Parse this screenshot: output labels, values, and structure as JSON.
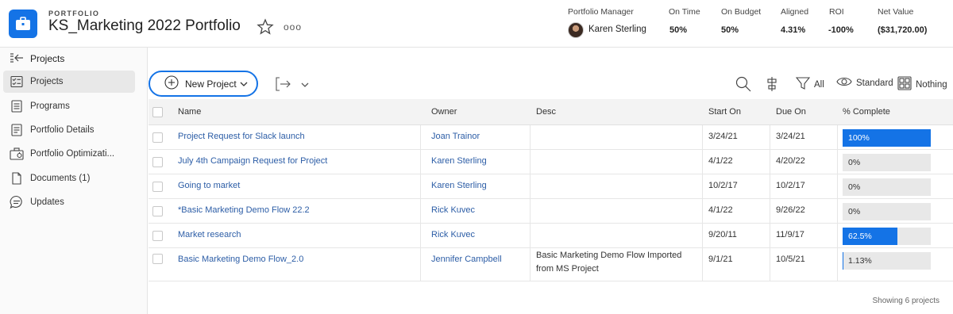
{
  "header": {
    "kicker": "PORTFOLIO",
    "title": "KS_Marketing 2022 Portfolio",
    "more_label": "ooo",
    "accent": "#1473e6"
  },
  "metrics": {
    "manager_label": "Portfolio Manager",
    "manager_name": "Karen Sterling",
    "on_time_label": "On Time",
    "on_time_value": "50%",
    "on_budget_label": "On Budget",
    "on_budget_value": "50%",
    "aligned_label": "Aligned",
    "aligned_value": "4.31%",
    "roi_label": "ROI",
    "roi_value": "-100%",
    "net_value_label": "Net Value",
    "net_value_value": "($31,720.00)"
  },
  "sidebar": {
    "back_label": "Projects",
    "items": [
      {
        "label": "Projects",
        "icon": "projects-icon",
        "active": true
      },
      {
        "label": "Programs",
        "icon": "programs-icon",
        "active": false
      },
      {
        "label": "Portfolio Details",
        "icon": "details-icon",
        "active": false
      },
      {
        "label": "Portfolio Optimizati...",
        "icon": "optimizer-icon",
        "active": false
      },
      {
        "label": "Documents (1)",
        "icon": "document-icon",
        "active": false
      },
      {
        "label": "Updates",
        "icon": "comment-icon",
        "active": false
      }
    ]
  },
  "toolbar": {
    "new_project_label": "New Project",
    "filter_label": "All",
    "view_label": "Standard",
    "grouping_label": "Nothing"
  },
  "table": {
    "columns": [
      "Name",
      "Owner",
      "Desc",
      "Start On",
      "Due On",
      "% Complete"
    ],
    "rows": [
      {
        "name": "Project Request for Slack launch",
        "owner": "Joan Trainor",
        "desc": "",
        "start": "3/24/21",
        "due": "3/24/21",
        "complete_label": "100%",
        "complete": 1.0
      },
      {
        "name": "July 4th Campaign Request for Project",
        "owner": "Karen Sterling",
        "desc": "",
        "start": "4/1/22",
        "due": "4/20/22",
        "complete_label": "0%",
        "complete": 0.0
      },
      {
        "name": "Going to market",
        "owner": "Karen Sterling",
        "desc": "",
        "start": "10/2/17",
        "due": "10/2/17",
        "complete_label": "0%",
        "complete": 0.0
      },
      {
        "name": "*Basic Marketing Demo Flow 22.2",
        "owner": "Rick Kuvec",
        "desc": "",
        "start": "4/1/22",
        "due": "9/26/22",
        "complete_label": "0%",
        "complete": 0.0
      },
      {
        "name": "Market research",
        "owner": "Rick Kuvec",
        "desc": "",
        "start": "9/20/11",
        "due": "11/9/17",
        "complete_label": "62.5%",
        "complete": 0.625
      },
      {
        "name": "Basic Marketing Demo Flow_2.0",
        "owner": "Jennifer Campbell",
        "desc": "Basic Marketing Demo Flow Imported from MS Project",
        "start": "9/1/21",
        "due": "10/5/21",
        "complete_label": "1.13%",
        "complete": 0.0113
      }
    ],
    "footer": "Showing 6 projects"
  }
}
